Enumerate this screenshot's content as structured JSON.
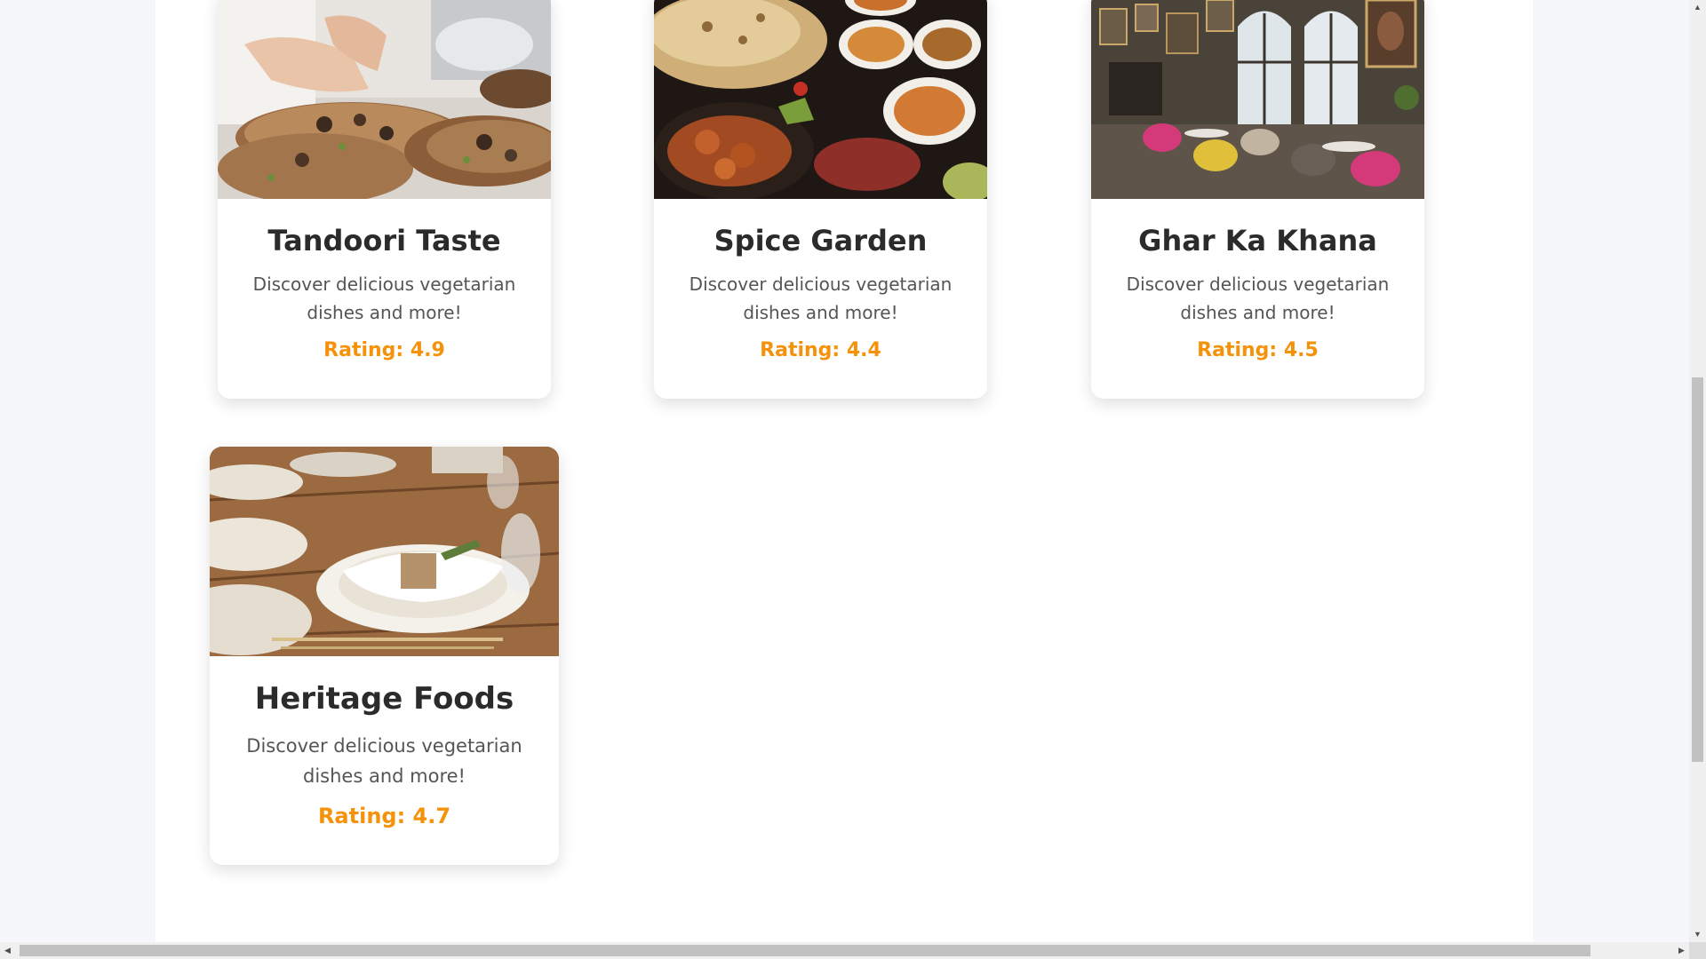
{
  "restaurants": [
    {
      "name": "Tandoori Taste",
      "description": "Discover delicious vegetarian dishes and more!",
      "rating_label": "Rating: 4.9",
      "rating": 4.9,
      "image_subject": "chef plating dishes on wooden slabs"
    },
    {
      "name": "Spice Garden",
      "description": "Discover delicious vegetarian dishes and more!",
      "rating_label": "Rating: 4.4",
      "rating": 4.4,
      "image_subject": "naan bread and curry bowls"
    },
    {
      "name": "Ghar Ka Khana",
      "description": "Discover delicious vegetarian dishes and more!",
      "rating_label": "Rating: 4.5",
      "rating": 4.5,
      "image_subject": "restaurant interior with colorful chairs"
    },
    {
      "name": "Heritage Foods",
      "description": "Discover delicious vegetarian dishes and more!",
      "rating_label": "Rating: 4.7",
      "rating": 4.7,
      "image_subject": "table setting with napkin and plates"
    }
  ],
  "colors": {
    "rating": "#f5920a",
    "title": "#2b2b2b",
    "description": "#555555",
    "page_background": "#f5f7fa",
    "card_background": "#ffffff"
  },
  "scrollbar_icons": {
    "up": "▲",
    "down": "▼",
    "left": "◀",
    "right": "▶"
  }
}
